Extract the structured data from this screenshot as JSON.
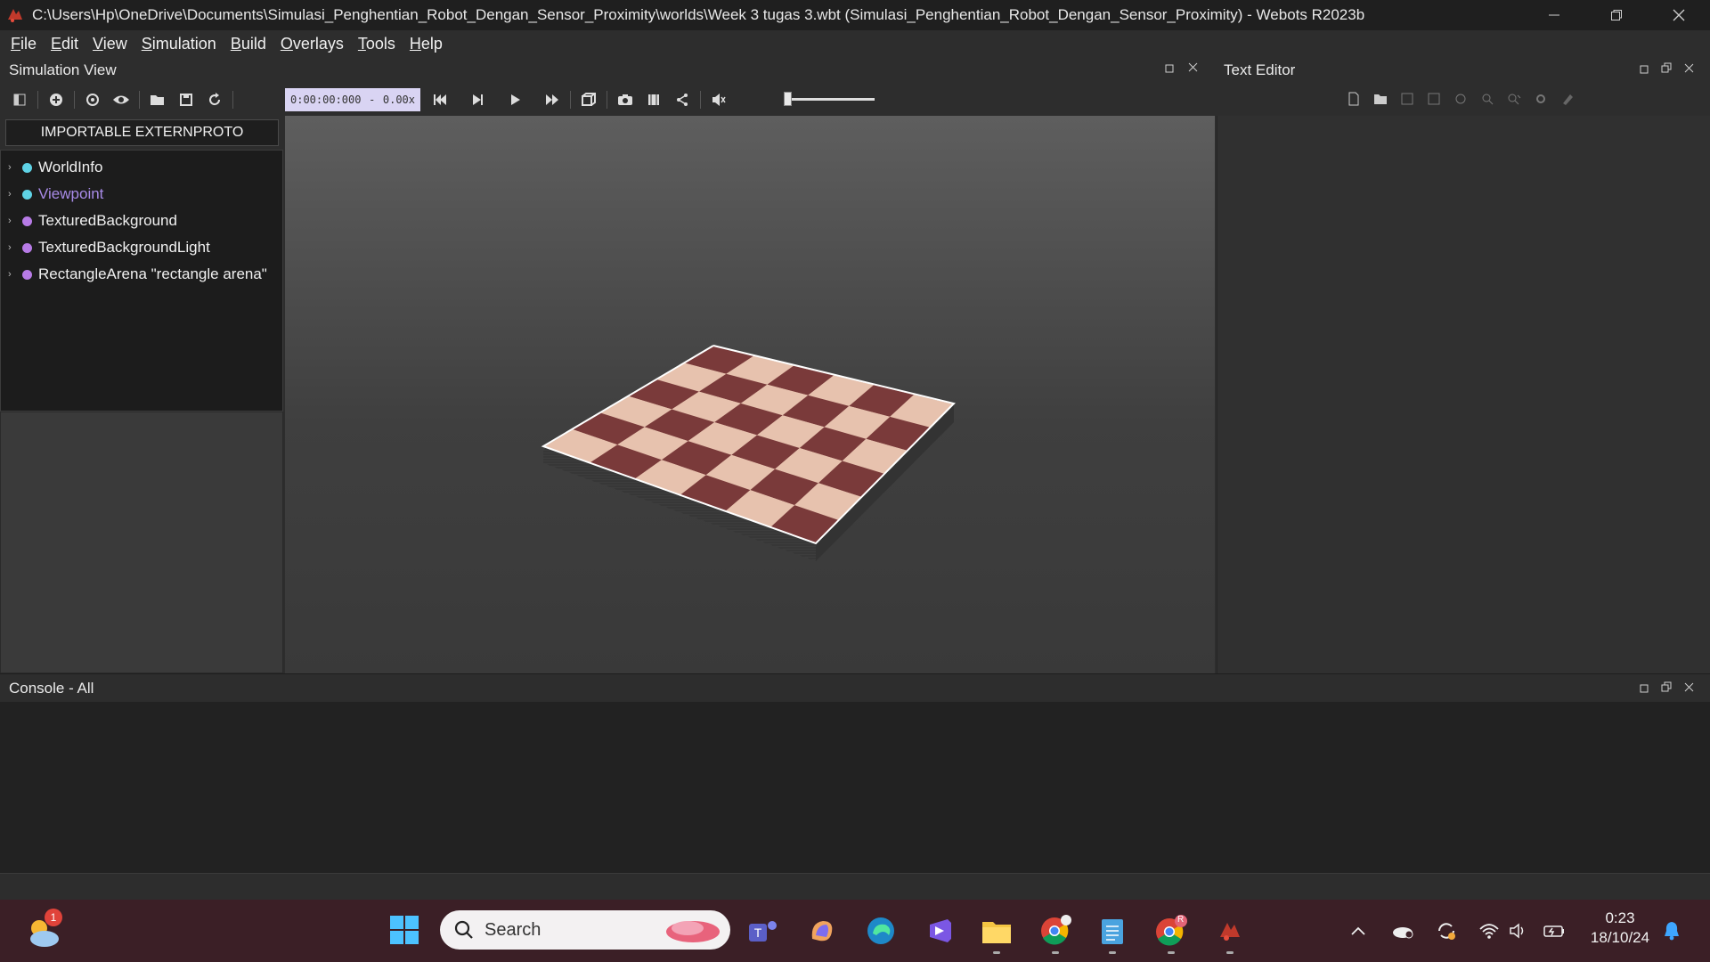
{
  "window": {
    "title": "C:\\Users\\Hp\\OneDrive\\Documents\\Simulasi_Penghentian_Robot_Dengan_Sensor_Proximity\\worlds\\Week 3 tugas 3.wbt (Simulasi_Penghentian_Robot_Dengan_Sensor_Proximity) - Webots R2023b",
    "controls": [
      "minimize",
      "restore",
      "close"
    ]
  },
  "menu": [
    {
      "key": "F",
      "rest": "ile"
    },
    {
      "key": "E",
      "rest": "dit"
    },
    {
      "key": "V",
      "rest": "iew"
    },
    {
      "key": "S",
      "rest": "imulation"
    },
    {
      "key": "B",
      "rest": "uild"
    },
    {
      "key": "O",
      "rest": "verlays"
    },
    {
      "key": "T",
      "rest": "ools"
    },
    {
      "key": "H",
      "rest": "elp"
    }
  ],
  "simulation_view": {
    "title": "Simulation View",
    "time": "0:00:00:000",
    "separator": "-",
    "speed": "0.00x"
  },
  "scene_tree": {
    "import_button": "IMPORTABLE EXTERNPROTO",
    "items": [
      {
        "label": "WorldInfo",
        "dot_color": "#5fd3e6",
        "label_color": "#f0f0f0"
      },
      {
        "label": "Viewpoint",
        "dot_color": "#5fd3e6",
        "label_color": "#a88be8"
      },
      {
        "label": "TexturedBackground",
        "dot_color": "#b77be6",
        "label_color": "#f0f0f0"
      },
      {
        "label": "TexturedBackgroundLight",
        "dot_color": "#b77be6",
        "label_color": "#f0f0f0"
      },
      {
        "label": "RectangleArena \"rectangle arena\"",
        "dot_color": "#b77be6",
        "label_color": "#f0f0f0"
      }
    ]
  },
  "text_editor": {
    "title": "Text Editor"
  },
  "console": {
    "title": "Console - All"
  },
  "taskbar": {
    "weather_badge": "1",
    "search_placeholder": "Search",
    "clock_time": "0:23",
    "clock_date": "18/10/24",
    "chrome_profile_badge": "R"
  },
  "colors": {
    "accent_time_box": "#d9d4f3",
    "taskbar_bg": "#3b1f26"
  }
}
